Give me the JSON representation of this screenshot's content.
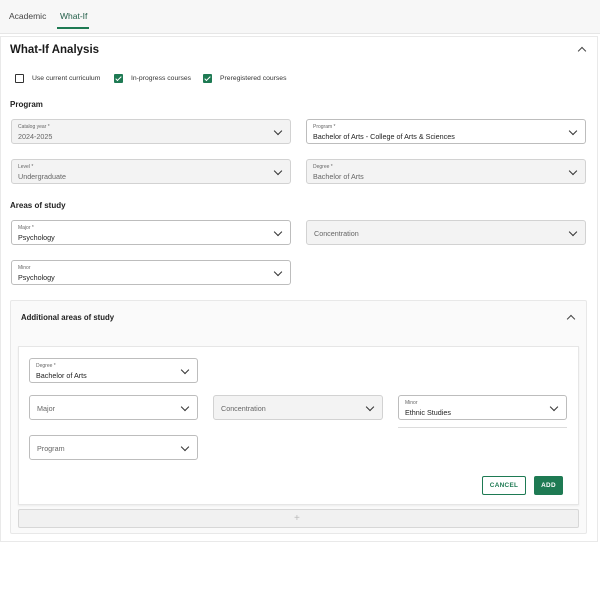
{
  "tabs": [
    {
      "label": "Academic",
      "active": false
    },
    {
      "label": "What-If",
      "active": true
    }
  ],
  "panel": {
    "title": "What-If Analysis",
    "options": [
      {
        "label": "Use current curriculum",
        "checked": false
      },
      {
        "label": "In-progress courses",
        "checked": true
      },
      {
        "label": "Preregistered courses",
        "checked": true
      }
    ]
  },
  "program_section": {
    "heading": "Program",
    "catalog_year": {
      "label": "Catalog year *",
      "value": "2024-2025"
    },
    "program": {
      "label": "Program *",
      "value": "Bachelor of Arts - College of Arts & Sciences"
    },
    "level": {
      "label": "Level *",
      "value": "Undergraduate"
    },
    "degree": {
      "label": "Degree *",
      "value": "Bachelor of Arts"
    }
  },
  "areas_section": {
    "heading": "Areas of study",
    "major": {
      "label": "Major *",
      "value": "Psychology"
    },
    "concentration": {
      "placeholder": "Concentration"
    },
    "minor": {
      "label": "Minor",
      "value": "Psychology"
    }
  },
  "additional": {
    "heading": "Additional areas of study",
    "degree": {
      "label": "Degree *",
      "value": "Bachelor of Arts"
    },
    "major": {
      "placeholder": "Major"
    },
    "concentration": {
      "placeholder": "Concentration"
    },
    "minor": {
      "label": "Minor",
      "value": "Ethnic Studies"
    },
    "program": {
      "placeholder": "Program"
    },
    "cancel_label": "CANCEL",
    "add_label": "ADD",
    "add_row_symbol": "+"
  },
  "colors": {
    "accent": "#1e7a53",
    "disabled_bg": "#f3f3f3"
  }
}
